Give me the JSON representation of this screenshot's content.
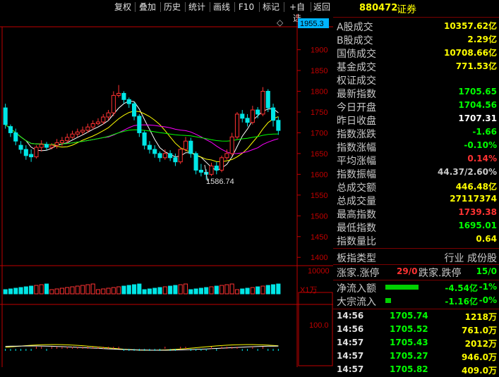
{
  "toolbar": {
    "buttons": [
      "复权",
      "叠加",
      "历史",
      "统计",
      "画线",
      "F10",
      "标记",
      "+自选",
      "返回"
    ]
  },
  "chart": {
    "top_label": "1955.3",
    "diamond_icon": "diamond-icon",
    "y_ticks": [
      "1900",
      "1850",
      "1800",
      "1750",
      "1700",
      "1650",
      "1600",
      "1550",
      "1500",
      "1450",
      "1400"
    ],
    "min_annotation": "1586.74",
    "volume_tick": "10000",
    "volume_unit": "X1万",
    "indicator_tick": "100.0",
    "colors": {
      "up": "#ff3232",
      "down": "#00e6e6",
      "ma5": "#ffffff",
      "ma10": "#ffff00",
      "ma20": "#ff00ff",
      "ma60": "#00ff00",
      "axis": "#c00000"
    }
  },
  "chart_data": {
    "type": "candlestick",
    "ylim": [
      1380,
      1955.3
    ],
    "min_label": 1586.74,
    "candles": [
      [
        1760,
        1720,
        1770,
        1710
      ],
      [
        1715,
        1700,
        1720,
        1690
      ],
      [
        1700,
        1680,
        1710,
        1670
      ],
      [
        1670,
        1660,
        1680,
        1650
      ],
      [
        1660,
        1645,
        1670,
        1635
      ],
      [
        1648,
        1642,
        1660,
        1630
      ],
      [
        1642,
        1665,
        1670,
        1638
      ],
      [
        1665,
        1672,
        1682,
        1655
      ],
      [
        1672,
        1665,
        1678,
        1658
      ],
      [
        1665,
        1670,
        1675,
        1660
      ],
      [
        1670,
        1676,
        1685,
        1662
      ],
      [
        1676,
        1681,
        1690,
        1668
      ],
      [
        1681,
        1689,
        1698,
        1675
      ],
      [
        1689,
        1697,
        1705,
        1685
      ],
      [
        1697,
        1702,
        1710,
        1690
      ],
      [
        1702,
        1706,
        1715,
        1695
      ],
      [
        1706,
        1714,
        1722,
        1700
      ],
      [
        1714,
        1722,
        1730,
        1708
      ],
      [
        1722,
        1726,
        1735,
        1718
      ],
      [
        1726,
        1738,
        1745,
        1720
      ],
      [
        1738,
        1748,
        1755,
        1730
      ],
      [
        1748,
        1790,
        1800,
        1740
      ],
      [
        1790,
        1795,
        1815,
        1785
      ],
      [
        1795,
        1780,
        1800,
        1770
      ],
      [
        1780,
        1770,
        1785,
        1760
      ],
      [
        1770,
        1740,
        1775,
        1730
      ],
      [
        1740,
        1700,
        1745,
        1690
      ],
      [
        1700,
        1670,
        1705,
        1660
      ],
      [
        1670,
        1660,
        1680,
        1650
      ],
      [
        1660,
        1650,
        1670,
        1640
      ],
      [
        1650,
        1640,
        1655,
        1630
      ],
      [
        1640,
        1650,
        1660,
        1635
      ],
      [
        1650,
        1640,
        1658,
        1632
      ],
      [
        1640,
        1630,
        1650,
        1620
      ],
      [
        1630,
        1660,
        1665,
        1625
      ],
      [
        1660,
        1680,
        1690,
        1655
      ],
      [
        1680,
        1650,
        1688,
        1640
      ],
      [
        1650,
        1610,
        1655,
        1600
      ],
      [
        1610,
        1605,
        1625,
        1595
      ],
      [
        1605,
        1600,
        1612,
        1586.74
      ],
      [
        1600,
        1620,
        1628,
        1596
      ],
      [
        1620,
        1610,
        1630,
        1600
      ],
      [
        1610,
        1640,
        1645,
        1605
      ],
      [
        1640,
        1650,
        1660,
        1635
      ],
      [
        1650,
        1690,
        1700,
        1645
      ],
      [
        1690,
        1745,
        1750,
        1685
      ],
      [
        1745,
        1735,
        1755,
        1725
      ],
      [
        1735,
        1725,
        1745,
        1715
      ],
      [
        1725,
        1755,
        1765,
        1720
      ],
      [
        1755,
        1745,
        1762,
        1735
      ],
      [
        1745,
        1800,
        1810,
        1740
      ],
      [
        1800,
        1760,
        1805,
        1750
      ],
      [
        1760,
        1730,
        1770,
        1715
      ],
      [
        1730,
        1705.65,
        1738,
        1695
      ]
    ]
  },
  "panel": {
    "title_code": "880472",
    "title_name": "证券",
    "rows": [
      {
        "label": "A股成交",
        "value": "10357.62亿",
        "color": "#ffff00"
      },
      {
        "label": "B股成交",
        "value": "2.29亿",
        "color": "#ffff00"
      },
      {
        "label": "国债成交",
        "value": "10708.66亿",
        "color": "#ffff00"
      },
      {
        "label": "基金成交",
        "value": "771.53亿",
        "color": "#ffff00"
      },
      {
        "label": "权证成交",
        "value": "",
        "color": "#ffff00"
      },
      {
        "label": "最新指数",
        "value": "1705.65",
        "color": "#00ff00"
      },
      {
        "label": "今日开盘",
        "value": "1704.56",
        "color": "#00ff00"
      },
      {
        "label": "昨日收盘",
        "value": "1707.31",
        "color": "#ffffff"
      },
      {
        "label": "指数涨跌",
        "value": "-1.66",
        "color": "#00ff00"
      },
      {
        "label": "指数涨幅",
        "value": "-0.10%",
        "color": "#00ff00"
      },
      {
        "label": "平均涨幅",
        "value": "0.14%",
        "color": "#ff3232"
      },
      {
        "label": "指数振幅",
        "value": "44.37/2.60%",
        "color": "#c8c8c8"
      },
      {
        "label": "总成交额",
        "value": "446.48亿",
        "color": "#ffff00"
      },
      {
        "label": "总成交量",
        "value": "27117374",
        "color": "#ffff00"
      },
      {
        "label": "最高指数",
        "value": "1739.38",
        "color": "#ff3232"
      },
      {
        "label": "最低指数",
        "value": "1695.01",
        "color": "#00ff00"
      },
      {
        "label": "指数量比",
        "value": "0.64",
        "color": "#ffff00"
      }
    ],
    "type_row": {
      "label": "板指类型",
      "value": "行业 成份股"
    },
    "limit_row": {
      "up_label": "涨家.涨停",
      "up_value": "29/0",
      "down_label": "跌家.跌停",
      "down_value": "15/0"
    },
    "flow_rows": [
      {
        "label": "净流入额",
        "value": "-4.54亿",
        "pct": "-1%",
        "bar": 0.9
      },
      {
        "label": "大宗流入",
        "value": "-1.16亿",
        "pct": "-0%",
        "bar": 0.15
      }
    ],
    "ticks": [
      {
        "time": "14:56",
        "price": "1705.74",
        "vol": "1218万"
      },
      {
        "time": "14:56",
        "price": "1705.52",
        "vol": "761.0万"
      },
      {
        "time": "14:57",
        "price": "1705.43",
        "vol": "2012万"
      },
      {
        "time": "14:57",
        "price": "1705.27",
        "vol": "946.0万"
      },
      {
        "time": "14:57",
        "price": "1705.82",
        "vol": "409.0万"
      }
    ]
  }
}
